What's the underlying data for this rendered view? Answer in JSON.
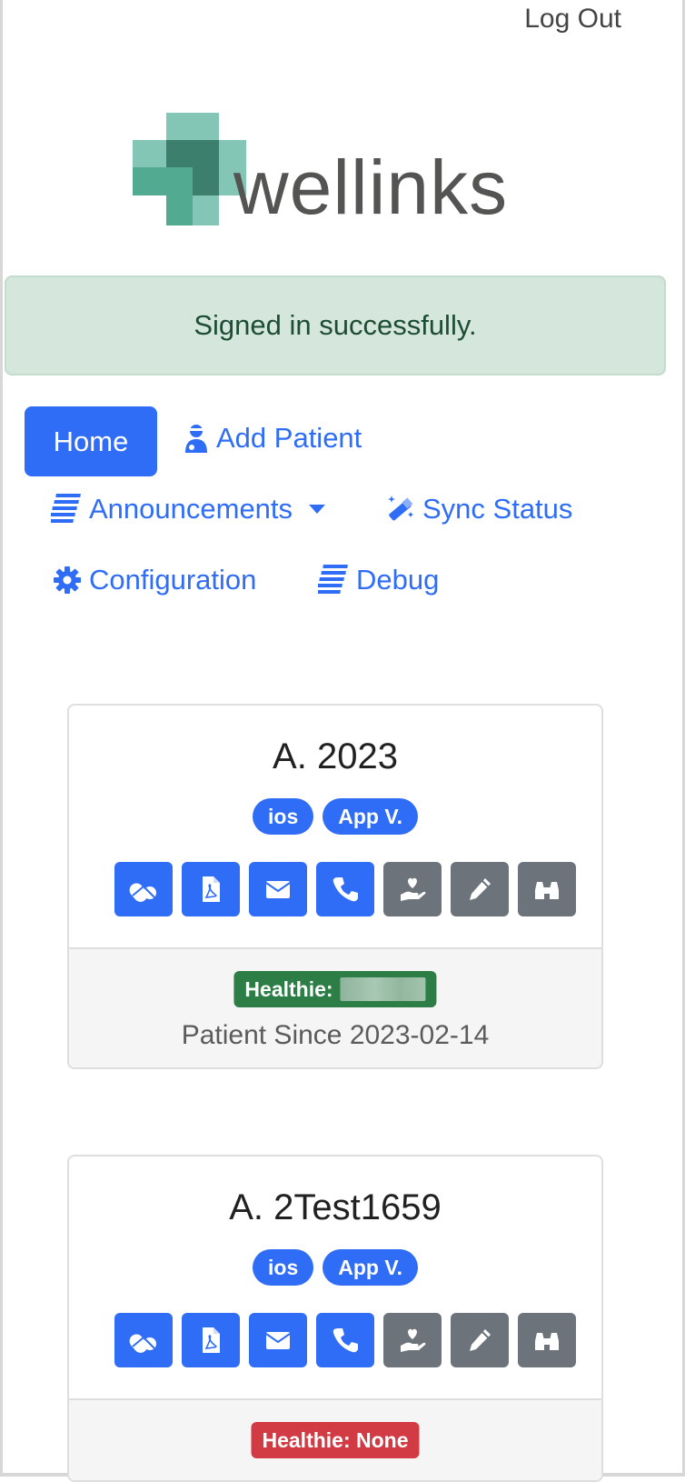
{
  "header": {
    "logout_label": "Log Out"
  },
  "brand": {
    "name": "wellinks",
    "colors": {
      "teal_light": "#84c6b5",
      "teal": "#52ab91",
      "teal_dark": "#3c7f6c",
      "text": "#545453"
    }
  },
  "alert": {
    "message": "Signed in successfully."
  },
  "nav": {
    "home": "Home",
    "add_patient": "Add Patient",
    "announcements": "Announcements",
    "sync_status": "Sync Status",
    "configuration": "Configuration",
    "debug": "Debug"
  },
  "patients": [
    {
      "name": "A. 2023",
      "badges": [
        "ios",
        "App V."
      ],
      "actions": [
        "pills-icon",
        "pdf-icon",
        "envelope-icon",
        "phone-icon",
        "hand-heart-icon",
        "pencil-icon",
        "binoculars-icon"
      ],
      "healthie": {
        "label": "Healthie:",
        "status": "linked"
      },
      "since": "Patient Since 2023-02-14"
    },
    {
      "name": "A. 2Test1659",
      "badges": [
        "ios",
        "App V."
      ],
      "actions": [
        "pills-icon",
        "pdf-icon",
        "envelope-icon",
        "phone-icon",
        "hand-heart-icon",
        "pencil-icon",
        "binoculars-icon"
      ],
      "healthie": {
        "label": "Healthie: None",
        "status": "none"
      }
    }
  ],
  "colors": {
    "primary": "#2f6df6",
    "secondary": "#6d737b",
    "success": "#2d7e46",
    "danger": "#d23a44"
  }
}
